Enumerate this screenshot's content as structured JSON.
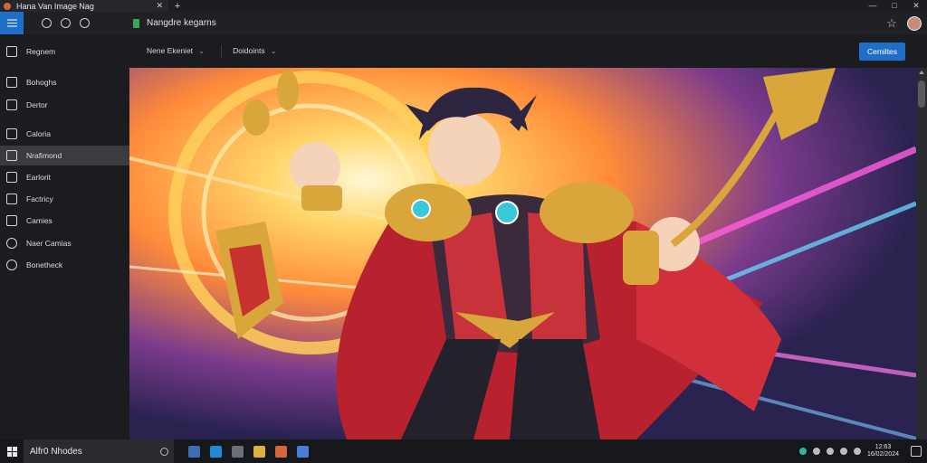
{
  "window": {
    "tab_title": "Hana Van Image Nag",
    "controls": {
      "minimize": "—",
      "maximize": "□",
      "close": "✕"
    },
    "newtab": "+",
    "tab_close": "✕"
  },
  "toolbar": {
    "url": "Nangdre kegarns",
    "icons": [
      "menu-icon",
      "refresh-icon",
      "history-icon",
      "globe-icon",
      "star-icon"
    ],
    "star": "☆"
  },
  "sidebar": {
    "items": [
      {
        "label": "Regnem",
        "icon": "pen-icon"
      },
      {
        "label": "Bohoghs",
        "icon": "list-icon"
      },
      {
        "label": "Dertor",
        "icon": "square-icon"
      },
      {
        "label": "Caloria",
        "icon": "folder-icon"
      },
      {
        "label": "Nrafimond",
        "icon": "image-icon",
        "active": true
      },
      {
        "label": "Earlorit",
        "icon": "doc-icon"
      },
      {
        "label": "Factricy",
        "icon": "shield-icon"
      },
      {
        "label": "Camies",
        "icon": "photo-icon"
      },
      {
        "label": "Naer Camias",
        "icon": "info-icon"
      },
      {
        "label": "Bonetheck",
        "icon": "circle-icon"
      }
    ]
  },
  "content_header": {
    "item1": "Nene Ekeniet",
    "item2": "Doidoints",
    "caret": "⌄",
    "action_button": "Cemiltes"
  },
  "taskbar": {
    "search_text": "Alfr0 Nhodes",
    "clock_time": "12:63",
    "clock_date": "16/02/2024",
    "apps": [
      {
        "name": "taskview-icon",
        "color": "#3c6fb0"
      },
      {
        "name": "edge-icon",
        "color": "#1f8ad8"
      },
      {
        "name": "store-icon",
        "color": "#6b6f78"
      },
      {
        "name": "files-icon",
        "color": "#d8b23a"
      },
      {
        "name": "media-icon",
        "color": "#d7643d"
      },
      {
        "name": "chat-icon",
        "color": "#4a7ed6"
      }
    ]
  }
}
